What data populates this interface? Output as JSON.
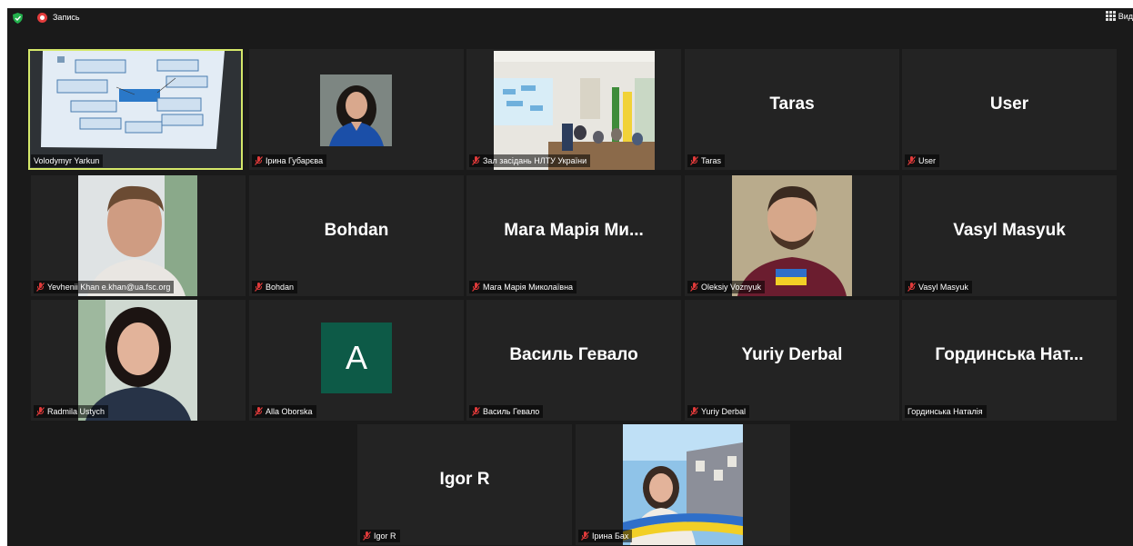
{
  "topbar": {
    "recording_label": "Запись",
    "view_label": "Вид"
  },
  "participants": [
    {
      "name": "Volodymyr Yarkun"
    },
    {
      "name": "Ірина Губарєва"
    },
    {
      "name": "Зал засідань НЛТУ України"
    },
    {
      "name": "Taras",
      "display": "Taras"
    },
    {
      "name": "User",
      "display": "User"
    },
    {
      "name": "Yevhenii Khan e.khan@ua.fsc.org"
    },
    {
      "name": "Bohdan",
      "display": "Bohdan"
    },
    {
      "name": "Мага Марія Миколаївна",
      "display": "Мага Марія Ми..."
    },
    {
      "name": "Oleksiy Voznyuk"
    },
    {
      "name": "Vasyl Masyuk",
      "display": "Vasyl Masyuk"
    },
    {
      "name": "Radmila Ustych"
    },
    {
      "name": "Alla Oborska",
      "initial": "A"
    },
    {
      "name": "Василь Гевало",
      "display": "Василь Гевало"
    },
    {
      "name": "Yuriy Derbal",
      "display": "Yuriy Derbal"
    },
    {
      "name": "Гординська Наталія",
      "display": "Гординська Нат..."
    },
    {
      "name": "Igor R",
      "display": "Igor R"
    },
    {
      "name": "Ірина Бах"
    }
  ]
}
